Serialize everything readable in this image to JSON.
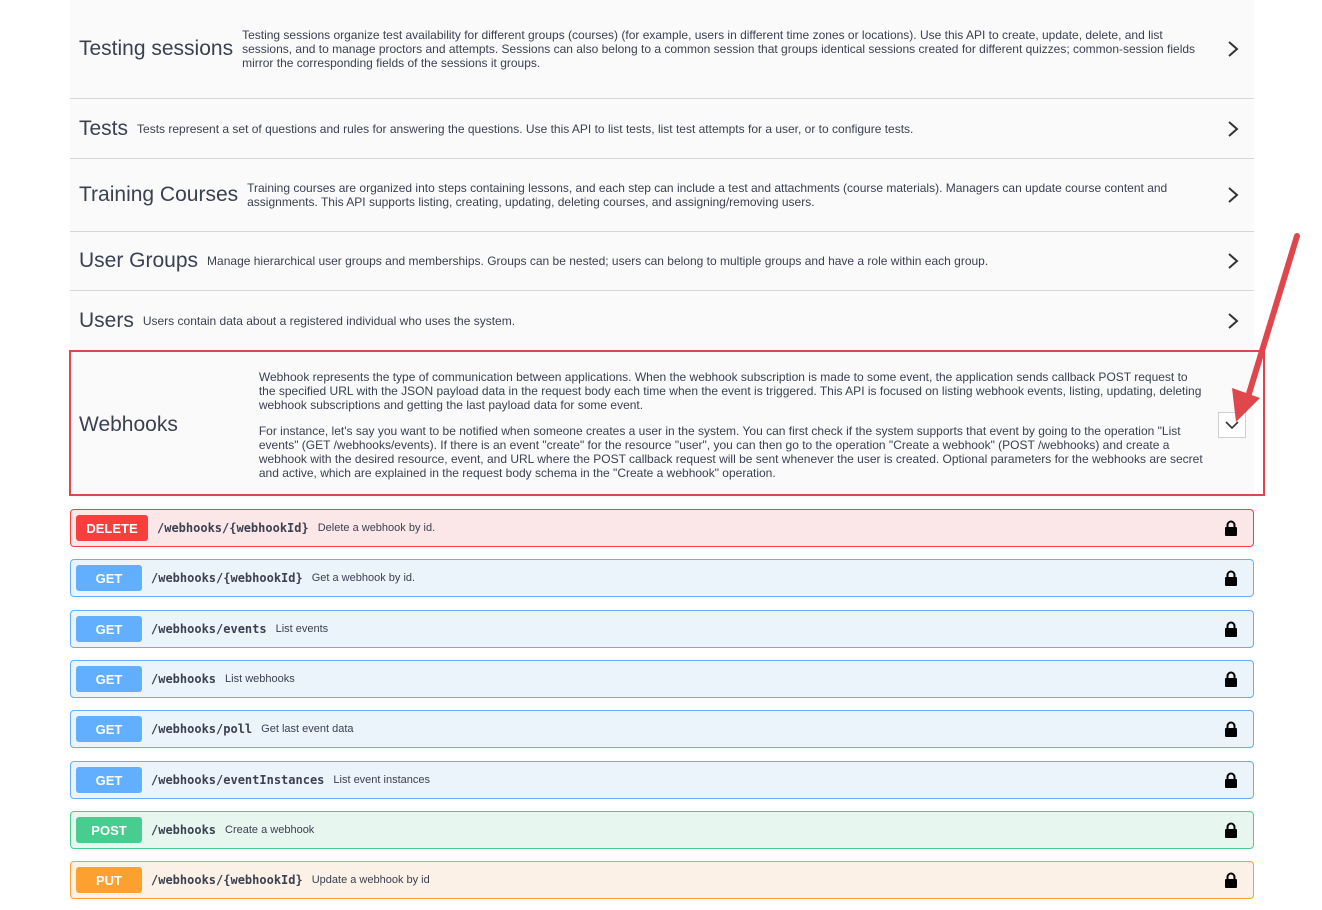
{
  "tags": [
    {
      "name": "Testing sessions",
      "description": "Testing sessions organize test availability for different groups (courses) (for example, users in different time zones or locations). Use this API to create, update, delete, and list sessions, and to manage proctors and attempts. Sessions can also belong to a common session that groups identical sessions created for different quizzes; common-session fields mirror the corresponding fields of the sessions it groups."
    },
    {
      "name": "Tests",
      "description": "Tests represent a set of questions and rules for answering the questions. Use this API to list tests, list test attempts for a user, or to configure tests."
    },
    {
      "name": "Training Courses",
      "description": "Training courses are organized into steps containing lessons, and each step can include a test and attachments (course materials). Managers can update course content and assignments. This API supports listing, creating, updating, deleting courses, and assigning/removing users."
    },
    {
      "name": "User Groups",
      "description": "Manage hierarchical user groups and memberships. Groups can be nested; users can belong to multiple groups and have a role within each group."
    },
    {
      "name": "Users",
      "description": "Users contain data about a registered individual who uses the system."
    }
  ],
  "webhooks": {
    "name": "Webhooks",
    "paragraph1": "Webhook represents the type of communication between applications. When the webhook subscription is made to some event, the application sends callback POST request to the specified URL with the JSON payload data in the request body each time when the event is triggered. This API is focused on listing webhook events, listing, updating, deleting webhook subscriptions and getting the last payload data for some event.",
    "paragraph2": "For instance, let's say you want to be notified when someone creates a user in the system. You can first check if the system supports that event by going to the operation \"List events\" (GET /webhooks/events). If there is an event \"create\" for the resource \"user\", you can then go to the operation \"Create a webhook\" (POST /webhooks) and create a webhook with the desired resource, event, and URL where the POST callback request will be sent whenever the user is created. Optional parameters for the webhooks are secret and active, which are explained in the request body schema in the \"Create a webhook\" operation."
  },
  "operations": [
    {
      "method": "DELETE",
      "path": "/webhooks/{webhookId}",
      "summary": "Delete a webhook by id."
    },
    {
      "method": "GET",
      "path": "/webhooks/{webhookId}",
      "summary": "Get a webhook by id."
    },
    {
      "method": "GET",
      "path": "/webhooks/events",
      "summary": "List events"
    },
    {
      "method": "GET",
      "path": "/webhooks",
      "summary": "List webhooks"
    },
    {
      "method": "GET",
      "path": "/webhooks/poll",
      "summary": "Get last event data"
    },
    {
      "method": "GET",
      "path": "/webhooks/eventInstances",
      "summary": "List event instances"
    },
    {
      "method": "POST",
      "path": "/webhooks",
      "summary": "Create a webhook"
    },
    {
      "method": "PUT",
      "path": "/webhooks/{webhookId}",
      "summary": "Update a webhook by id"
    }
  ],
  "colors": {
    "delete": "#f93e3e",
    "get": "#61affe",
    "post": "#49cc90",
    "put": "#fca130",
    "highlight": "#e0474c"
  },
  "icons": {
    "collapsed": "chevron-right-icon",
    "expanded": "chevron-down-icon",
    "auth": "lock-icon",
    "annotation": "red-arrow-icon"
  }
}
